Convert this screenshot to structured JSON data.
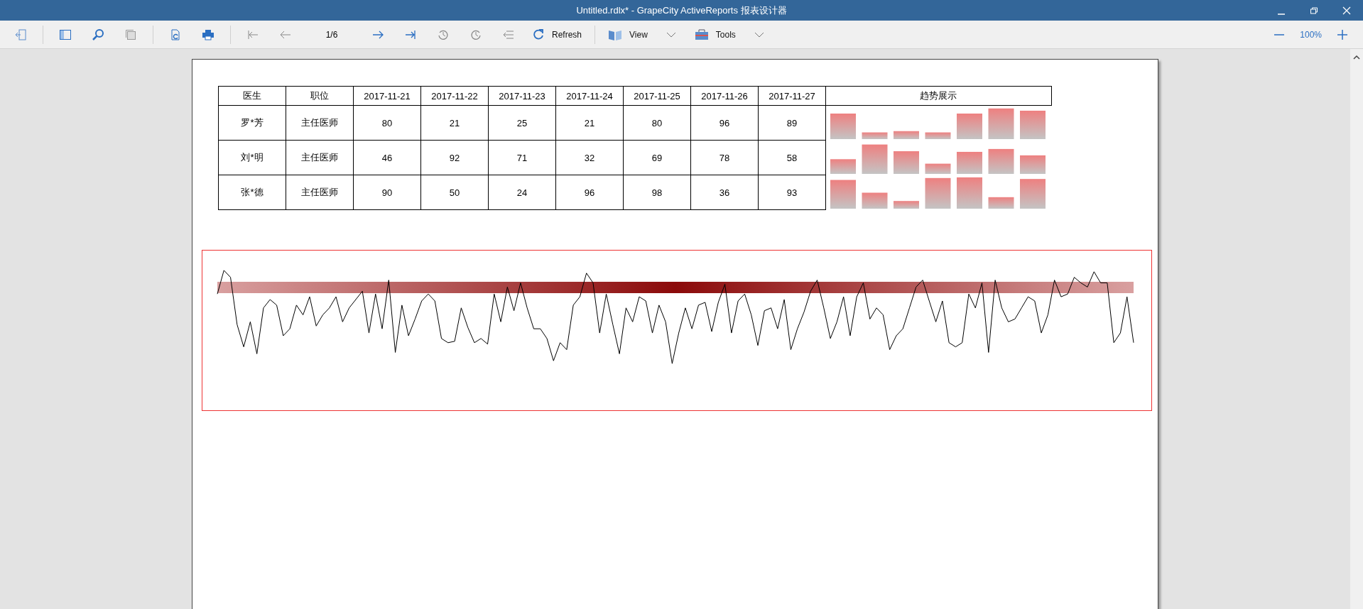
{
  "window": {
    "title": "Untitled.rdlx* - GrapeCity ActiveReports 报表设计器"
  },
  "toolbar": {
    "page_indicator": "1/6",
    "refresh": "Refresh",
    "view": "View",
    "tools": "Tools",
    "zoom": "100%"
  },
  "table": {
    "columns": [
      "医生",
      "职位",
      "2017-11-21",
      "2017-11-22",
      "2017-11-23",
      "2017-11-24",
      "2017-11-25",
      "2017-11-26",
      "2017-11-27",
      "趋势展示"
    ],
    "rows": [
      {
        "name": "罗*芳",
        "title": "主任医师",
        "values": [
          "80",
          "21",
          "25",
          "21",
          "80",
          "96",
          "89"
        ]
      },
      {
        "name": "刘*明",
        "title": "主任医师",
        "values": [
          "46",
          "92",
          "71",
          "32",
          "69",
          "78",
          "58"
        ]
      },
      {
        "name": "张*德",
        "title": "主任医师",
        "values": [
          "90",
          "50",
          "24",
          "96",
          "98",
          "36",
          "93"
        ]
      }
    ]
  }
}
